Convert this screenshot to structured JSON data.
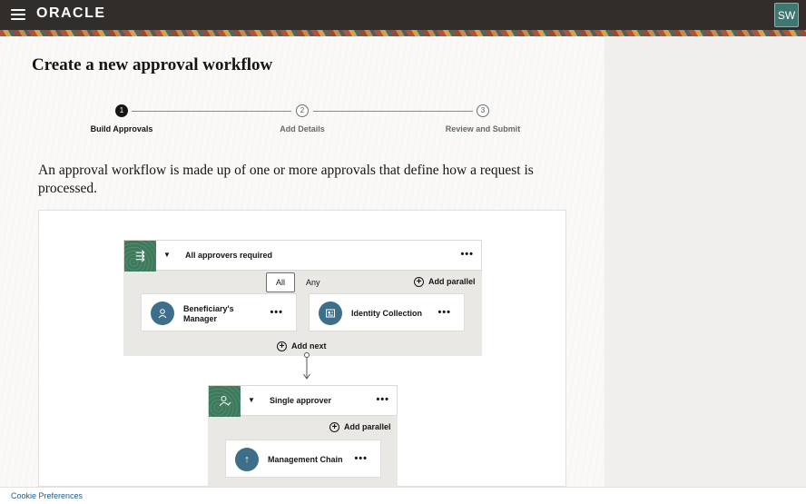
{
  "header": {
    "logo": "ORACLE",
    "user_initials": "SW"
  },
  "page": {
    "title": "Create a new approval workflow",
    "intro": "An approval workflow is made up of one or more approvals that define how a request is processed."
  },
  "steps": [
    {
      "number": "1",
      "label": "Build Approvals",
      "state": "active"
    },
    {
      "number": "2",
      "label": "Add Details",
      "state": "pending"
    },
    {
      "number": "3",
      "label": "Review and Submit",
      "state": "pending"
    }
  ],
  "workflow": {
    "group1": {
      "title": "All approvers required",
      "toggle_all": "All",
      "toggle_any": "Any",
      "add_parallel": "Add parallel",
      "cards": [
        {
          "label_line1": "Beneficiary's",
          "label_line2": "Manager",
          "icon": "person-icon"
        },
        {
          "label_line1": "Identity Collection",
          "label_line2": "",
          "icon": "identity-collection-icon"
        }
      ],
      "add_next": "Add next",
      "more": "•••"
    },
    "group2": {
      "title": "Single approver",
      "add_parallel": "Add parallel",
      "cards": [
        {
          "label_line1": "Management Chain",
          "label_line2": "",
          "icon": "arrow-up-icon"
        }
      ],
      "more": "•••"
    }
  },
  "footer": {
    "cookie_link": "Cookie Preferences"
  },
  "colors": {
    "topbar": "#312d2a",
    "accent_green": "#3d7a5c",
    "card_icon_blue": "#3d6f8a",
    "avatar": "#3f7770"
  }
}
